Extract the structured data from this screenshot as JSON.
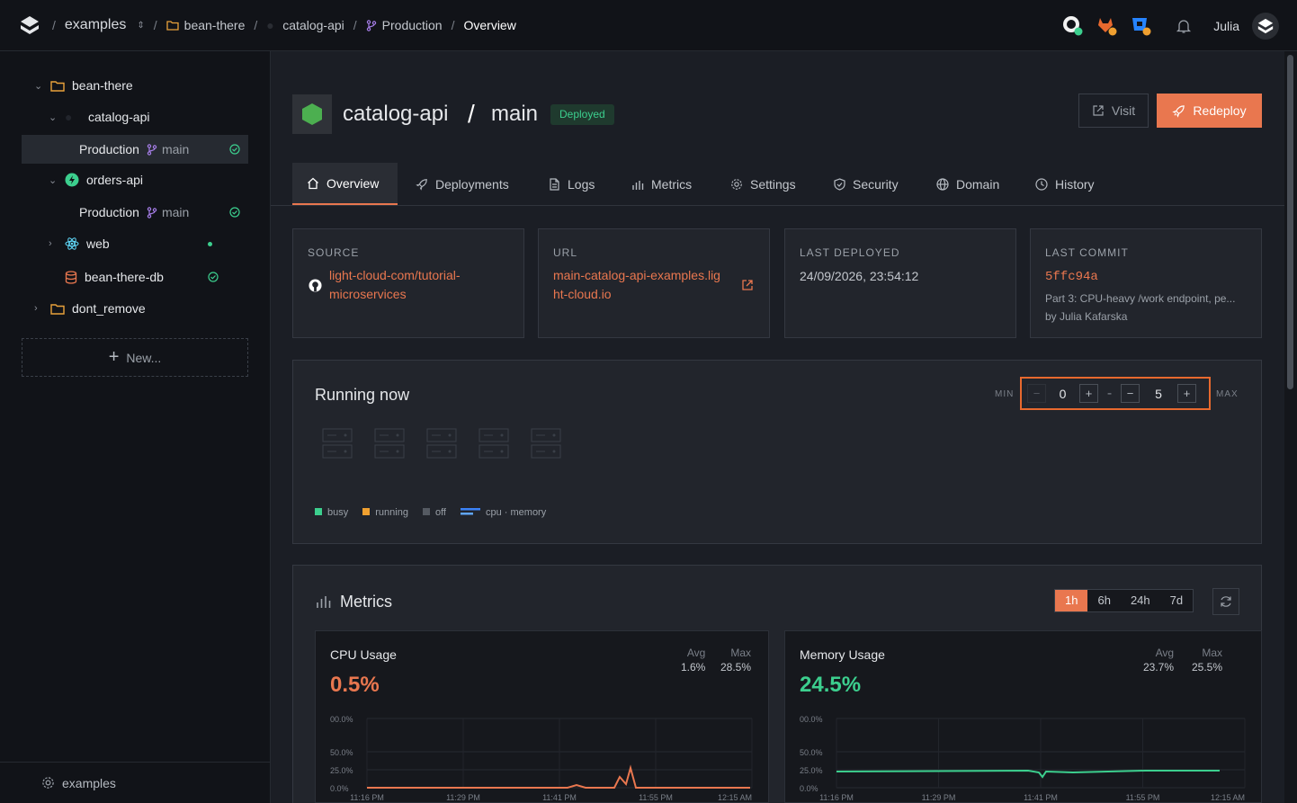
{
  "breadcrumbs": {
    "workspace": "examples",
    "project": "bean-there",
    "service": "catalog-api",
    "env": "Production",
    "page": "Overview"
  },
  "user": {
    "name": "Julia"
  },
  "sidebar": {
    "items": [
      {
        "label": "bean-there"
      },
      {
        "label": "catalog-api"
      },
      {
        "label": "Production",
        "branch": "main"
      },
      {
        "label": "orders-api"
      },
      {
        "label": "Production",
        "branch": "main"
      },
      {
        "label": "web"
      },
      {
        "label": "bean-there-db"
      },
      {
        "label": "dont_remove"
      }
    ],
    "new_label": "New...",
    "footer": "examples"
  },
  "header": {
    "service": "catalog-api",
    "slash": "/",
    "branch": "main",
    "status": "Deployed",
    "visit": "Visit",
    "redeploy": "Redeploy"
  },
  "tabs": [
    {
      "label": "Overview"
    },
    {
      "label": "Deployments"
    },
    {
      "label": "Logs"
    },
    {
      "label": "Metrics"
    },
    {
      "label": "Settings"
    },
    {
      "label": "Security"
    },
    {
      "label": "Domain"
    },
    {
      "label": "History"
    }
  ],
  "info": {
    "source": {
      "label": "SOURCE",
      "line1": "light-cloud-com/tutorial-",
      "line2": "microservices"
    },
    "url": {
      "label": "URL",
      "line1": "main-catalog-api-examples.lig",
      "line2": "ht-cloud.io"
    },
    "deployed": {
      "label": "LAST DEPLOYED",
      "value": "24/09/2026, 23:54:12"
    },
    "commit": {
      "label": "LAST COMMIT",
      "hash": "5ffc94a",
      "message": "Part 3: CPU-heavy /work endpoint, pe...",
      "author": "by Julia Kafarska"
    }
  },
  "running": {
    "title": "Running now",
    "min_label": "MIN",
    "min": "0",
    "max_label": "MAX",
    "max": "5",
    "dash": "-",
    "legend": {
      "busy": "busy",
      "running": "running",
      "off": "off",
      "cpu": "cpu · memory"
    }
  },
  "metrics": {
    "title": "Metrics",
    "ranges": [
      "1h",
      "6h",
      "24h",
      "7d"
    ],
    "selected_range": "1h",
    "cpu": {
      "title": "CPU Usage",
      "value": "0.5%",
      "avg_label": "Avg",
      "avg": "1.6%",
      "max_label": "Max",
      "max": "28.5%"
    },
    "memory": {
      "title": "Memory Usage",
      "value": "24.5%",
      "avg_label": "Avg",
      "avg": "23.7%",
      "max_label": "Max",
      "max": "25.5%"
    },
    "y_ticks": [
      "00.0%",
      "50.0%",
      "25.0%",
      "0.0%"
    ],
    "x_ticks": [
      "11:16 PM",
      "11:29 PM",
      "11:41 PM",
      "11:55 PM",
      "12:15 AM"
    ]
  },
  "colors": {
    "accent": "#e9774f",
    "success": "#3ccf8e",
    "branch": "#a67ee8"
  }
}
